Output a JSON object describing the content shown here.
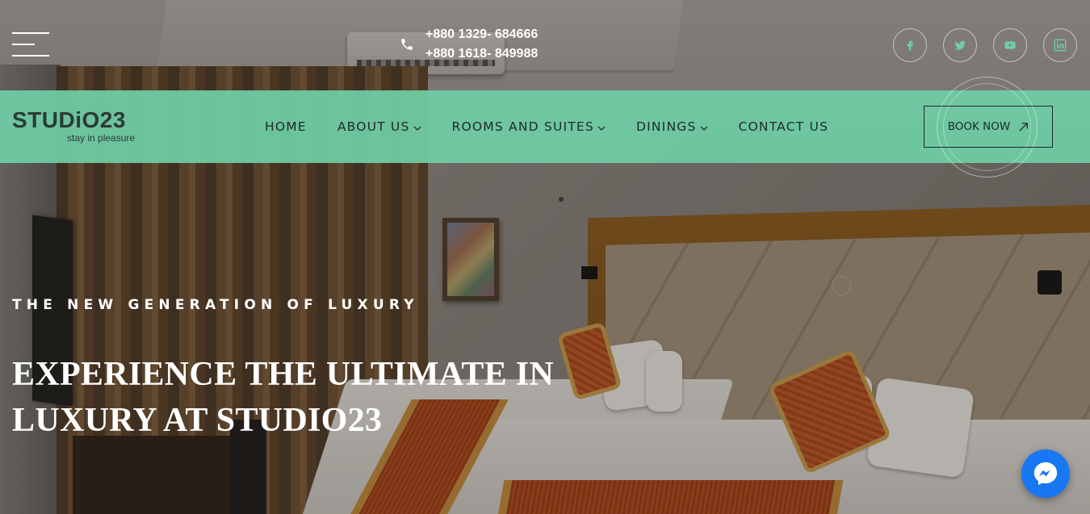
{
  "header": {
    "phones": [
      "+880 1329- 684666",
      "+880 1618- 849988"
    ],
    "social_icons": [
      "facebook-icon",
      "twitter-icon",
      "youtube-icon",
      "linkedin-icon"
    ]
  },
  "logo": {
    "main": "STUDiO23",
    "tagline": "stay in pleasure"
  },
  "nav": {
    "items": [
      {
        "label": "HOME",
        "dropdown": false
      },
      {
        "label": "ABOUT US",
        "dropdown": true
      },
      {
        "label": "ROOMS AND SUITES",
        "dropdown": true
      },
      {
        "label": "DININGS",
        "dropdown": true
      },
      {
        "label": "CONTACT US",
        "dropdown": false
      }
    ],
    "book_label": "BOOK NOW"
  },
  "hero": {
    "tagline": "THE NEW GENERATION OF LUXURY",
    "headline_line1": "EXPERIENCE THE ULTIMATE IN",
    "headline_line2": "LUXURY AT STUDIO23"
  },
  "colors": {
    "navbar": "#6fcda6",
    "messenger": "#1877f2",
    "text_dark": "#1f2a27"
  }
}
